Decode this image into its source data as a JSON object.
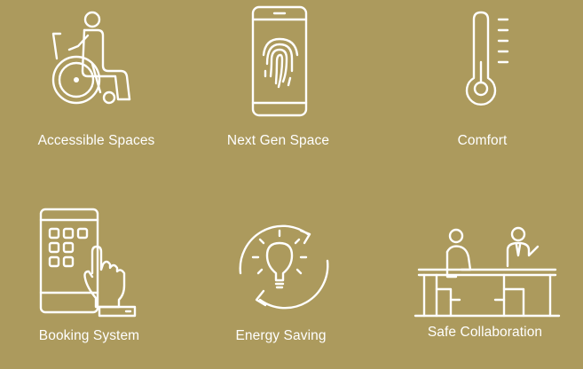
{
  "background_color": "#ac9a5d",
  "foreground_color": "#ffffff",
  "features": [
    {
      "label": "Accessible Spaces",
      "icon": "wheelchair-icon"
    },
    {
      "label": "Next Gen Space",
      "icon": "fingerprint-phone-icon"
    },
    {
      "label": "Comfort",
      "icon": "thermometer-icon"
    },
    {
      "label": "Booking System",
      "icon": "tablet-touch-icon"
    },
    {
      "label": "Energy Saving",
      "icon": "lightbulb-cycle-icon"
    },
    {
      "label": "Safe Collaboration",
      "icon": "meeting-desk-icon"
    }
  ]
}
